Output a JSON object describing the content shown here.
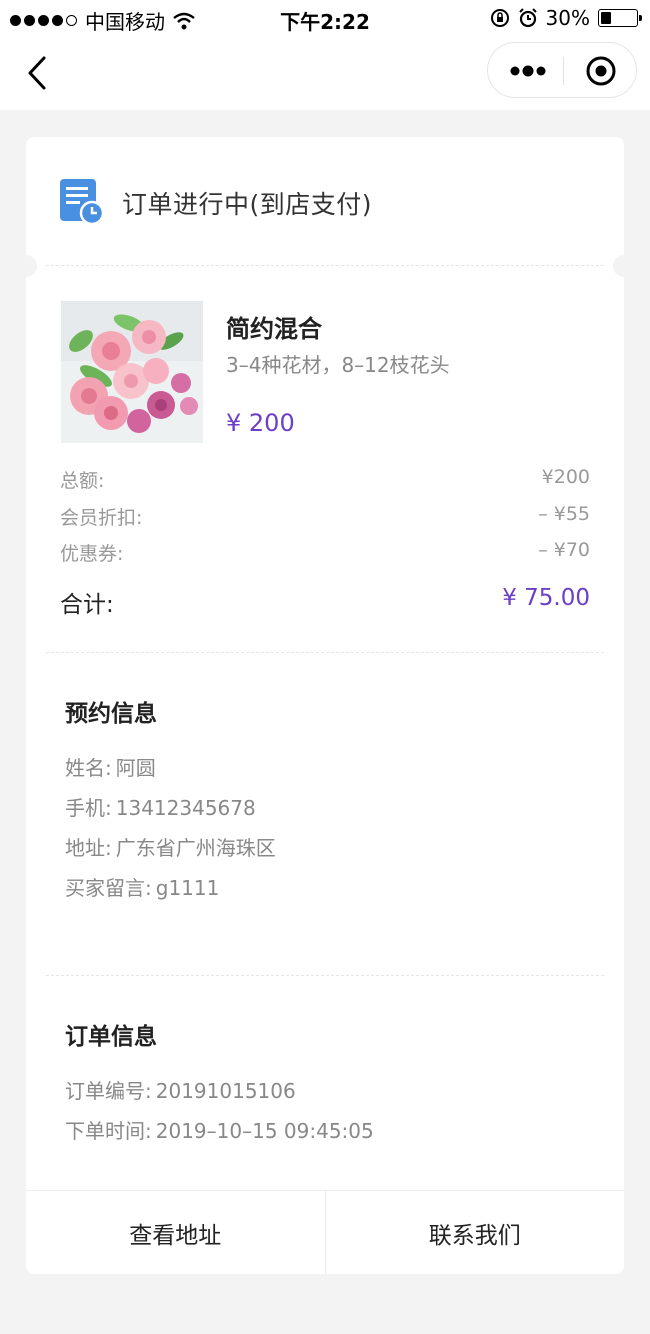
{
  "status_bar": {
    "carrier": "中国移动",
    "time": "下午2:22",
    "battery_text": "30%",
    "battery_level": 0.3
  },
  "nav": {
    "back_icon": "chevron-left-icon",
    "more_icon": "more-dots-icon",
    "close_icon": "target-circle-icon"
  },
  "order_status": {
    "text": "订单进行中(到店支付)",
    "icon": "document-clock-icon",
    "icon_color": "#4a90e2"
  },
  "product": {
    "name": "简约混合",
    "desc": "3–4种花材，8–12枝花头",
    "price": "¥ 200",
    "image": "pink-roses-image"
  },
  "fees": [
    {
      "label": "总额:",
      "value": "¥200"
    },
    {
      "label": "会员折扣:",
      "value": "– ¥55"
    },
    {
      "label": "优惠券:",
      "value": "– ¥70"
    }
  ],
  "total": {
    "label": "合计:",
    "value": "¥ 75.00"
  },
  "reservation": {
    "title": "预约信息",
    "name_label": "姓名:",
    "name": "阿圆",
    "phone_label": "手机:",
    "phone": "13412345678",
    "address_label": "地址:",
    "address": "广东省广州海珠区",
    "message_label": "买家留言:",
    "message": "g1111"
  },
  "order_info": {
    "title": "订单信息",
    "number_label": "订单编号:",
    "number": "20191015106",
    "time_label": "下单时间:",
    "time": "2019–10–15 09:45:05"
  },
  "footer": {
    "view_address": "查看地址",
    "contact_us": "联系我们"
  },
  "colors": {
    "accent": "#6b3fc6",
    "background": "#f3f3f3"
  }
}
